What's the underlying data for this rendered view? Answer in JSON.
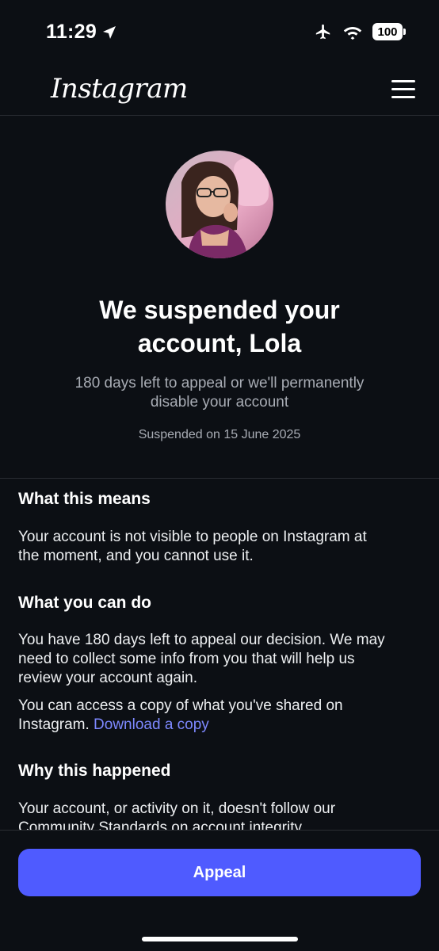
{
  "status_bar": {
    "time": "11:29",
    "battery": "100",
    "icons": [
      "location-arrow-icon",
      "airplane-icon",
      "wifi-icon",
      "battery-icon"
    ]
  },
  "header": {
    "logo": "Instagram",
    "menu_icon": "hamburger-menu-icon"
  },
  "hero": {
    "title_line1": "We suspended your",
    "title_line2": "account, Lola",
    "subtitle_line1": "180 days left to appeal or we'll permanently",
    "subtitle_line2": "disable your account",
    "suspended_date": "Suspended on 15 June 2025"
  },
  "sections": {
    "what_this_means": {
      "heading": "What this means",
      "body_line1": "Your account is not visible to people on Instagram at",
      "body_line2": "the moment, and you cannot use it."
    },
    "what_you_can_do": {
      "heading": "What you can do",
      "p1_line1": "You have 180 days left to appeal our decision. We may",
      "p1_line2": "need to collect some info from you that will help us",
      "p1_line3": "review your account again.",
      "p2_line1": "You can access a copy of what you've shared on",
      "p2_line2_prefix": "Instagram. ",
      "p2_link": "Download a copy"
    },
    "why_this_happened": {
      "heading": "Why this happened",
      "body_line1": "Your account, or activity on it, doesn't follow our",
      "body_line2": "Community Standards on account integrity"
    }
  },
  "footer": {
    "appeal_label": "Appeal"
  },
  "colors": {
    "background": "#0c0f14",
    "accent": "#4f5bff",
    "link": "#7d88ff",
    "muted_text": "#a8acb4"
  }
}
